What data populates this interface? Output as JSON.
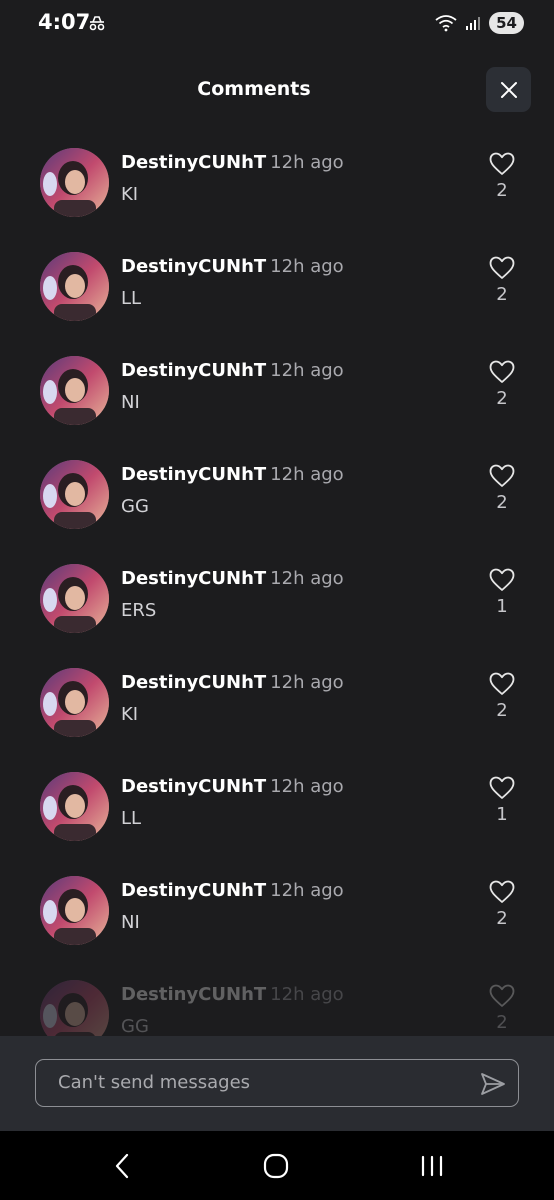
{
  "status_bar": {
    "time": "4:07",
    "battery": "54"
  },
  "header": {
    "title": "Comments",
    "close_icon": "close-icon"
  },
  "comments": [
    {
      "username": "DestinyCUNhT",
      "time": "12h ago",
      "text": "KI",
      "likes": "2"
    },
    {
      "username": "DestinyCUNhT",
      "time": "12h ago",
      "text": "LL",
      "likes": "2"
    },
    {
      "username": "DestinyCUNhT",
      "time": "12h ago",
      "text": "NI",
      "likes": "2"
    },
    {
      "username": "DestinyCUNhT",
      "time": "12h ago",
      "text": "GG",
      "likes": "2"
    },
    {
      "username": "DestinyCUNhT",
      "time": "12h ago",
      "text": "ERS",
      "likes": "1"
    },
    {
      "username": "DestinyCUNhT",
      "time": "12h ago",
      "text": "KI",
      "likes": "2"
    },
    {
      "username": "DestinyCUNhT",
      "time": "12h ago",
      "text": "LL",
      "likes": "1"
    },
    {
      "username": "DestinyCUNhT",
      "time": "12h ago",
      "text": "NI",
      "likes": "2"
    },
    {
      "username": "DestinyCUNhT",
      "time": "12h ago",
      "text": "GG",
      "likes": "2"
    }
  ],
  "input": {
    "placeholder": "Can't send messages",
    "send_icon": "send-icon"
  },
  "nav": {
    "back_icon": "back-icon",
    "home_icon": "home-icon",
    "recents_icon": "recents-icon"
  },
  "colors": {
    "background": "#1c1c1e",
    "input_bar": "#2a2c31",
    "timestamp": "#a9a9ae"
  }
}
